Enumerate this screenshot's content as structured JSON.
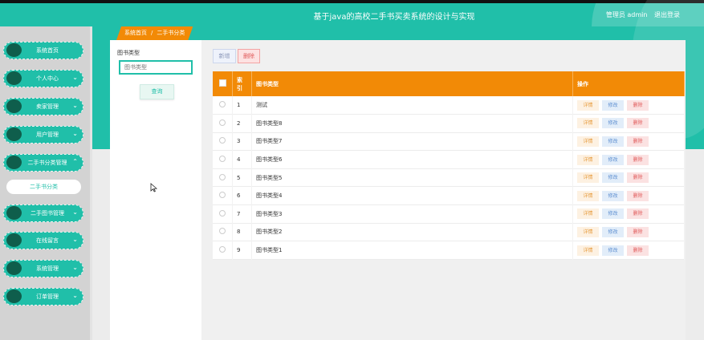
{
  "header": {
    "title": "基于java的高校二手书买卖系统的设计与实现",
    "user_text": "管理员 admin",
    "logout_label": "退出登录"
  },
  "sidebar": {
    "items": [
      {
        "label": "系统首页",
        "has_chevron": false
      },
      {
        "label": "个人中心",
        "has_chevron": true
      },
      {
        "label": "卖家管理",
        "has_chevron": true
      },
      {
        "label": "用户管理",
        "has_chevron": true
      },
      {
        "label": "二手书分类管理",
        "has_chevron": true,
        "expanded": true
      },
      {
        "label": "二手图书管理",
        "has_chevron": true
      },
      {
        "label": "在线留言",
        "has_chevron": true
      },
      {
        "label": "系统管理",
        "has_chevron": true
      },
      {
        "label": "订单管理",
        "has_chevron": true
      }
    ],
    "subitem": {
      "label": "二手书分类"
    }
  },
  "breadcrumb": {
    "home": "系统首页",
    "separator": "/",
    "current": "二手书分类"
  },
  "search": {
    "label": "图书类型",
    "placeholder": "图书类型",
    "query_label": "查询"
  },
  "toolbar": {
    "add_label": "新增",
    "delete_label": "删除"
  },
  "table": {
    "columns": {
      "index": "索引",
      "type": "图书类型",
      "ops": "操作"
    },
    "rows": [
      {
        "index": "1",
        "type": "测试"
      },
      {
        "index": "2",
        "type": "图书类型8"
      },
      {
        "index": "3",
        "type": "图书类型7"
      },
      {
        "index": "4",
        "type": "图书类型6"
      },
      {
        "index": "5",
        "type": "图书类型5"
      },
      {
        "index": "6",
        "type": "图书类型4"
      },
      {
        "index": "7",
        "type": "图书类型3"
      },
      {
        "index": "8",
        "type": "图书类型2"
      },
      {
        "index": "9",
        "type": "图书类型1"
      }
    ],
    "row_actions": {
      "detail": "详情",
      "edit": "修改",
      "delete": "删除"
    }
  },
  "colors": {
    "primary": "#20bfa9",
    "accent": "#f28a06",
    "dark_dot": "#0f5e4c"
  }
}
